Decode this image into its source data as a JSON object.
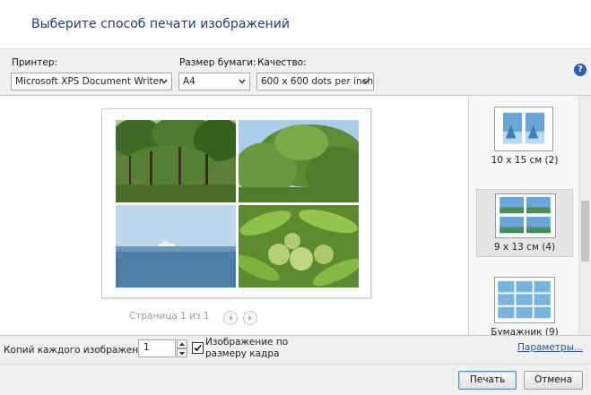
{
  "dialog": {
    "title": "Выберите способ печати изображений"
  },
  "printer": {
    "label": "Принтер:",
    "value": "Microsoft XPS Document Writer"
  },
  "paper": {
    "label": "Размер бумаги:",
    "value": "A4"
  },
  "quality": {
    "label": "Качество:",
    "value": "600 x 600 dots per inch"
  },
  "help": {
    "glyph": "?"
  },
  "preview": {
    "page_indicator": "Страница 1 из 1",
    "photos": [
      "forest",
      "tree-canopy",
      "sea-with-boat",
      "chestnut-leaves"
    ]
  },
  "layouts": {
    "items": [
      {
        "label": "10 x 15 см (2)",
        "selected": false
      },
      {
        "label": "9 x 13 см (4)",
        "selected": true
      },
      {
        "label": "Бумажник (9)",
        "selected": false
      }
    ]
  },
  "copies": {
    "label": "Копий каждого изображения:",
    "value": "1"
  },
  "fit": {
    "label": "Изображение по размеру кадра",
    "checked": true
  },
  "params_link": "Параметры...",
  "buttons": {
    "print": "Печать",
    "cancel": "Отмена"
  },
  "colors": {
    "title": "#1f3b7a",
    "link": "#1f55b0",
    "help": "#2b5fb3"
  }
}
